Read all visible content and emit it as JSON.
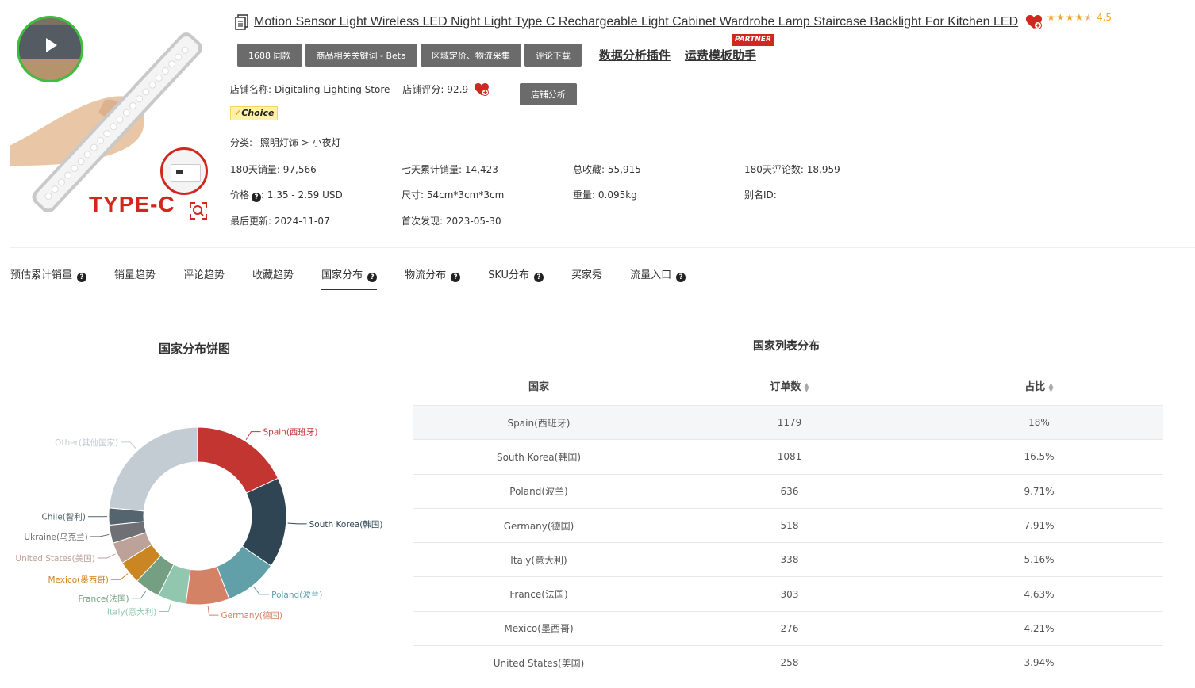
{
  "product": {
    "title": "Motion Sensor Light Wireless LED Night Light Type C Rechargeable Light Cabinet Wardrobe Lamp Staircase Backlight For Kitchen LED",
    "image_label": "TYPE-C",
    "rating": "4.5",
    "star_count": 4.5
  },
  "buttons": {
    "b1688": "1688 同款",
    "keywords": "商品相关关键词 - Beta",
    "region": "区域定价、物流采集",
    "review_dl": "评论下载",
    "plugin_link": "数据分析插件",
    "template_link": "运费模板助手",
    "partner": "PARTNER",
    "store_analysis": "店铺分析"
  },
  "store": {
    "name_label": "店铺名称:",
    "name": "Digitaling Lighting Store",
    "score_label": "店铺评分:",
    "score": "92.9",
    "choice": "Choice"
  },
  "category": {
    "label": "分类:",
    "path": "照明灯饰 > 小夜灯"
  },
  "stats": {
    "sales180_label": "180天销量:",
    "sales180": "97,566",
    "sales7_label": "七天累计销量:",
    "sales7": "14,423",
    "fav_label": "总收藏:",
    "fav": "55,915",
    "rev180_label": "180天评论数:",
    "rev180": "18,959",
    "price_label": "价格",
    "price": "1.35 - 2.59 USD",
    "size_label": "尺寸:",
    "size": "54cm*3cm*3cm",
    "weight_label": "重量:",
    "weight": "0.095kg",
    "alias_label": "别名ID:",
    "updated_label": "最后更新:",
    "updated": "2024-11-07",
    "first_label": "首次发现:",
    "first": "2023-05-30"
  },
  "tabs": [
    {
      "label": "预估累计销量",
      "help": true
    },
    {
      "label": "销量趋势",
      "help": false
    },
    {
      "label": "评论趋势",
      "help": false
    },
    {
      "label": "收藏趋势",
      "help": false
    },
    {
      "label": "国家分布",
      "help": true,
      "active": true
    },
    {
      "label": "物流分布",
      "help": true
    },
    {
      "label": "SKU分布",
      "help": true
    },
    {
      "label": "买家秀",
      "help": false
    },
    {
      "label": "流量入口",
      "help": true
    }
  ],
  "pie": {
    "title": "国家分布饼图",
    "chart_data": {
      "type": "pie",
      "slices": [
        {
          "name": "Spain(西班牙)",
          "value": 18,
          "color": "#c23531"
        },
        {
          "name": "South Korea(韩国)",
          "value": 16.5,
          "color": "#2f4554"
        },
        {
          "name": "Poland(波兰)",
          "value": 9.71,
          "color": "#61a0a8"
        },
        {
          "name": "Germany(德国)",
          "value": 7.91,
          "color": "#d48265"
        },
        {
          "name": "Italy(意大利)",
          "value": 5.16,
          "color": "#91c7ae"
        },
        {
          "name": "France(法国)",
          "value": 4.63,
          "color": "#749f83"
        },
        {
          "name": "Mexico(墨西哥)",
          "value": 4.21,
          "color": "#ca8622"
        },
        {
          "name": "United States(美国)",
          "value": 3.94,
          "color": "#bda29a"
        },
        {
          "name": "Ukraine(乌克兰)",
          "value": 3.3,
          "color": "#6e7074"
        },
        {
          "name": "Chile(智利)",
          "value": 3.1,
          "color": "#546570"
        },
        {
          "name": "Other(其他国家)",
          "value": 23.54,
          "color": "#c4ccd3"
        }
      ]
    }
  },
  "table": {
    "title": "国家列表分布",
    "headers": [
      "国家",
      "订单数",
      "占比"
    ],
    "rows": [
      [
        "Spain(西班牙)",
        "1179",
        "18%"
      ],
      [
        "South Korea(韩国)",
        "1081",
        "16.5%"
      ],
      [
        "Poland(波兰)",
        "636",
        "9.71%"
      ],
      [
        "Germany(德国)",
        "518",
        "7.91%"
      ],
      [
        "Italy(意大利)",
        "338",
        "5.16%"
      ],
      [
        "France(法国)",
        "303",
        "4.63%"
      ],
      [
        "Mexico(墨西哥)",
        "276",
        "4.21%"
      ],
      [
        "United States(美国)",
        "258",
        "3.94%"
      ]
    ]
  }
}
